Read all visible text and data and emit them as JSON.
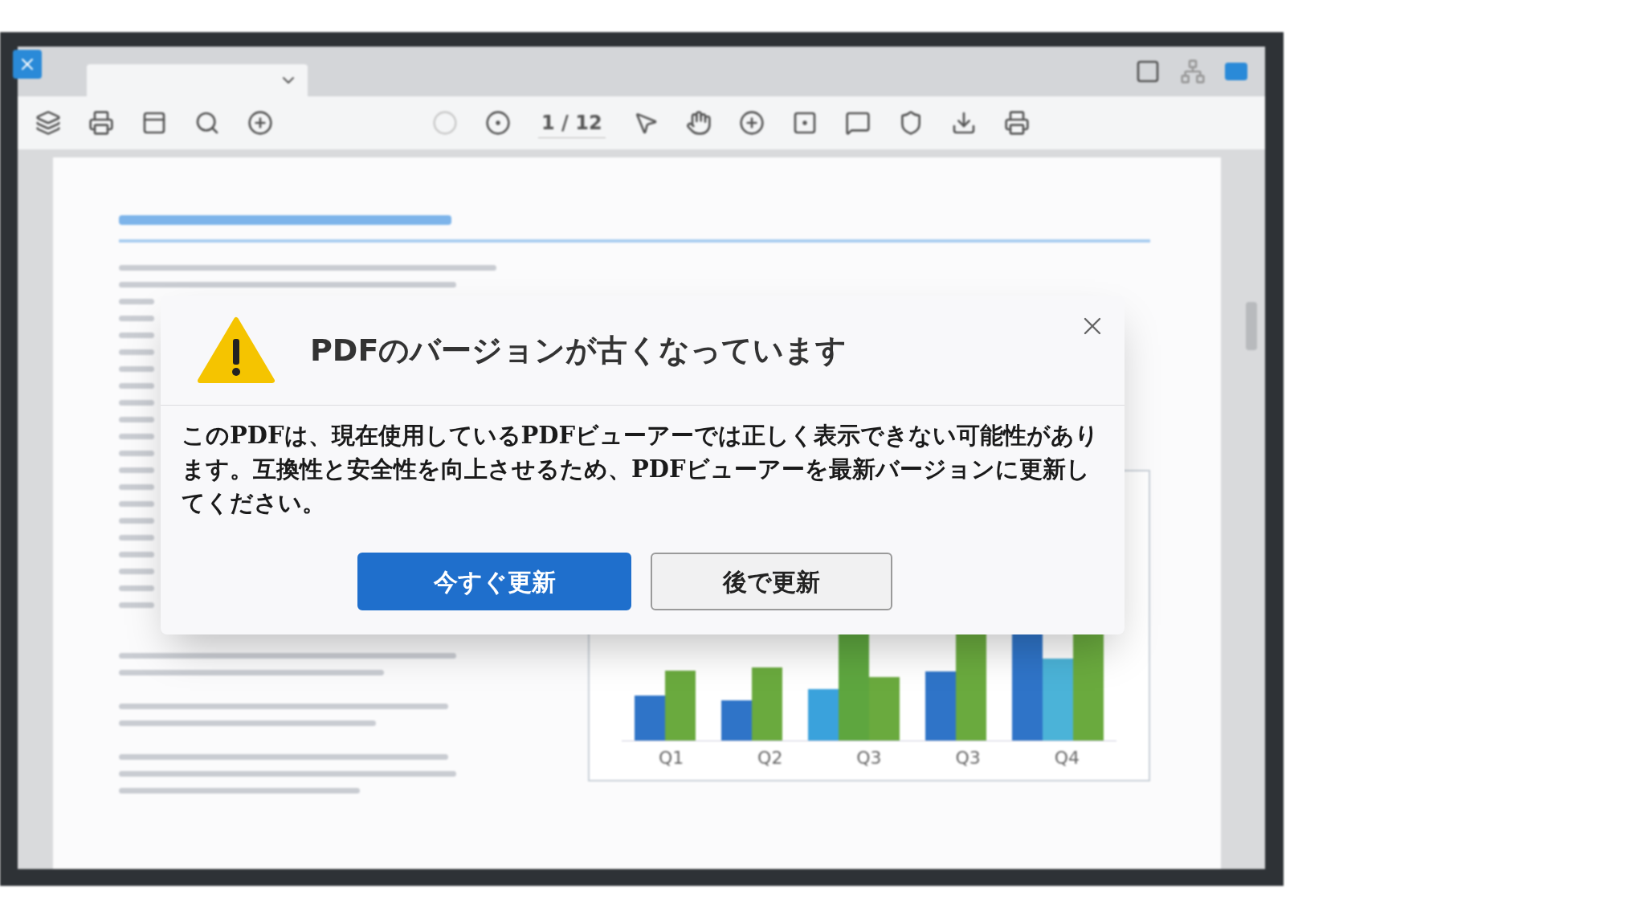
{
  "toolbar": {
    "page_indicator": "1 / 12"
  },
  "chart": {
    "categories": [
      "Q1",
      "Q2",
      "Q3",
      "Q3",
      "Q4"
    ]
  },
  "dialog": {
    "title": "PDFのバージョンが古くなっています",
    "message": "このPDFは、現在使用しているPDFビューアーでは正しく表示できない可能性があります。互換性と安全性を向上させるため、PDFビューアーを最新バージョンに更新してください。",
    "buttons": [
      {
        "label": "今すぐ更新",
        "kind": "primary"
      },
      {
        "label": "後で更新",
        "kind": "secondary"
      }
    ]
  }
}
